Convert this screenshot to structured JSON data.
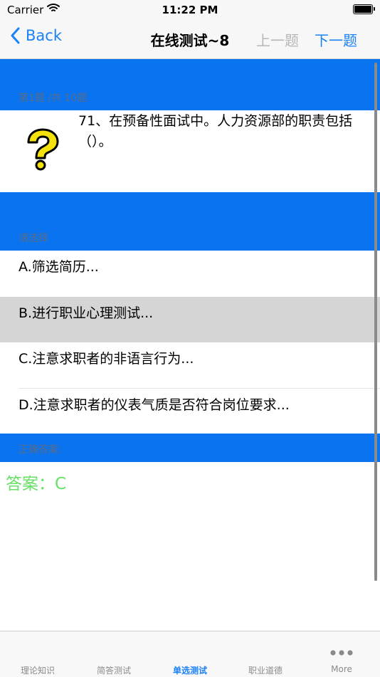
{
  "status_bar": {
    "carrier": "Carrier",
    "time": "11:22 PM"
  },
  "nav": {
    "back_label": "Back",
    "title": "在线测试~8",
    "prev_label": "上一题",
    "next_label": "下一题"
  },
  "question_section": {
    "header": "第1题 /共 10题",
    "text": "71、在预备性面试中。人力资源部的职责包括（）。"
  },
  "options_section": {
    "header": "请选择",
    "options": [
      {
        "label": "A.筛选简历..."
      },
      {
        "label": "B.进行职业心理测试..."
      },
      {
        "label": "C.注意求职者的非语言行为..."
      },
      {
        "label": "D.注意求职者的仪表气质是否符合岗位要求..."
      }
    ],
    "selected_index": 1
  },
  "answer_section": {
    "header": "正确答案:",
    "answer": "答案：C"
  },
  "tab_bar": {
    "tabs": [
      {
        "label": "理论知识"
      },
      {
        "label": "简答测试"
      },
      {
        "label": "单选测试"
      },
      {
        "label": "职业道德"
      },
      {
        "label": "More"
      }
    ],
    "active_index": 2
  },
  "colors": {
    "accent": "#1a82f7",
    "band": "#0a73f0",
    "answer": "#66e066",
    "selected_bg": "#d5d5d5"
  }
}
